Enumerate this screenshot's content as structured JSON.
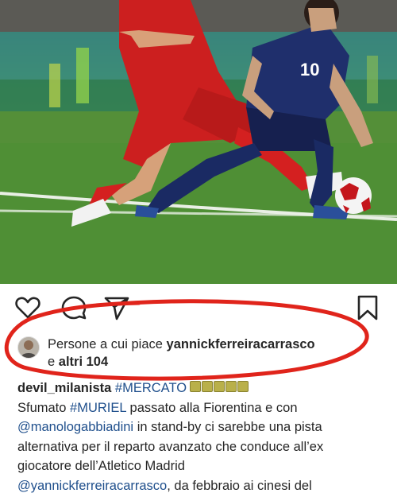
{
  "post": {
    "image_alt": "Belgium vs Japan football match photo"
  },
  "actions": {
    "like_icon": "heart-icon",
    "comment_icon": "comment-icon",
    "share_icon": "send-icon",
    "save_icon": "bookmark-icon"
  },
  "likes": {
    "prefix": "Persone a cui piace ",
    "user": "yannickferreiracarrasco",
    "conjunction": "e ",
    "others": "altri 104"
  },
  "caption": {
    "username": "devil_milanista",
    "hashtag_mercato": "#MERCATO",
    "line2_a": "Sfumato ",
    "line2_hashtag": "#MURIEL",
    "line2_b": " passato alla Fiorentina e con",
    "line3_mention": "@manologabbiadini",
    "line3_b": " in stand-by ci sarebbe una pista",
    "line4": "alternativa per il reparto avanzato che conduce all’ex",
    "line5": "giocatore dell’Atletico Madrid",
    "line6_mention": "@yannickferreiracarrasco",
    "line6_b": ", da febbraio ai cinesi del"
  },
  "colors": {
    "annotation_red": "#e0241b",
    "link_blue": "#1f4f8c"
  }
}
